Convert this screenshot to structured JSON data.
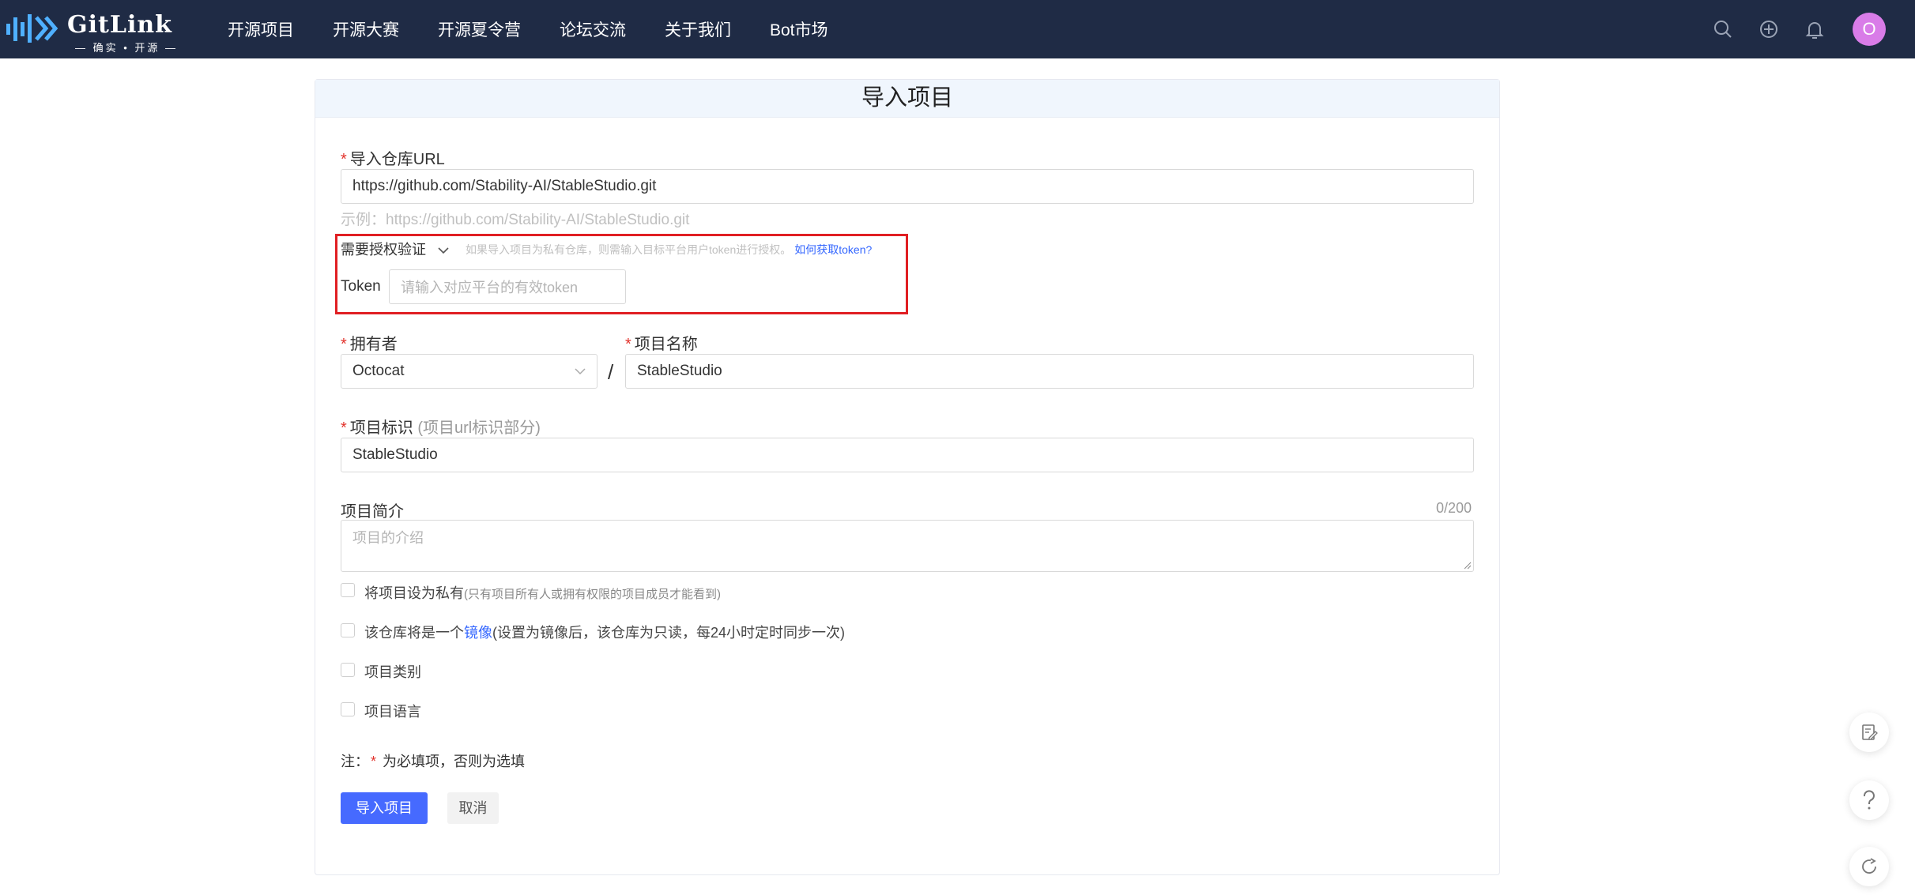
{
  "brand": {
    "name": "GitLink",
    "tagline": "— 确实 • 开源 —"
  },
  "nav": [
    "开源项目",
    "开源大赛",
    "开源夏令营",
    "论坛交流",
    "关于我们",
    "Bot市场"
  ],
  "header_icons": [
    "search-icon",
    "plus-circle-icon",
    "bell-icon"
  ],
  "user": {
    "avatar_letter": "O",
    "avatar_color": "#d97ce8"
  },
  "page_title": "导入项目",
  "form": {
    "repo_url": {
      "required_mark": "*",
      "label": "导入仓库URL",
      "value": "https://github.com/Stability-AI/StableStudio.git",
      "example": "示例：https://github.com/Stability-AI/StableStudio.git"
    },
    "auth": {
      "toggle_label": "需要授权验证",
      "hint": "如果导入项目为私有仓库，则需输入目标平台用户token进行授权。",
      "help_link": "如何获取token?",
      "token_label": "Token",
      "token_placeholder": "请输入对应平台的有效token"
    },
    "owner": {
      "required_mark": "*",
      "label": "拥有者",
      "value": "Octocat"
    },
    "separator": "/",
    "project_name": {
      "required_mark": "*",
      "label": "项目名称",
      "value": "StableStudio"
    },
    "identifier": {
      "required_mark": "*",
      "label": "项目标识",
      "note": "(项目url标识部分)",
      "value": "StableStudio"
    },
    "description": {
      "label": "项目简介",
      "counter": "0/200",
      "placeholder": "项目的介绍"
    },
    "private": {
      "label": "将项目设为私有",
      "note": "(只有项目所有人或拥有权限的项目成员才能看到)",
      "checked": false
    },
    "mirror": {
      "label_before": "该仓库将是一个",
      "link": "镜像",
      "note": "(设置为镜像后，该仓库为只读，每24小时定时同步一次)",
      "checked": false
    },
    "category": {
      "label": "项目类别",
      "checked": false
    },
    "language": {
      "label": "项目语言",
      "checked": false
    },
    "footnote": {
      "prefix": "注：",
      "mark": "*",
      "text": "为必填项，否则为选填"
    },
    "submit_label": "导入项目",
    "cancel_label": "取消"
  },
  "floating_icons": [
    "edit-note-icon",
    "help-icon",
    "refresh-icon"
  ],
  "colors": {
    "nav_bg": "#1f2b45",
    "primary": "#466aff",
    "required": "#e2322b",
    "highlight_box": "#e01f23",
    "link": "#3366ff"
  }
}
